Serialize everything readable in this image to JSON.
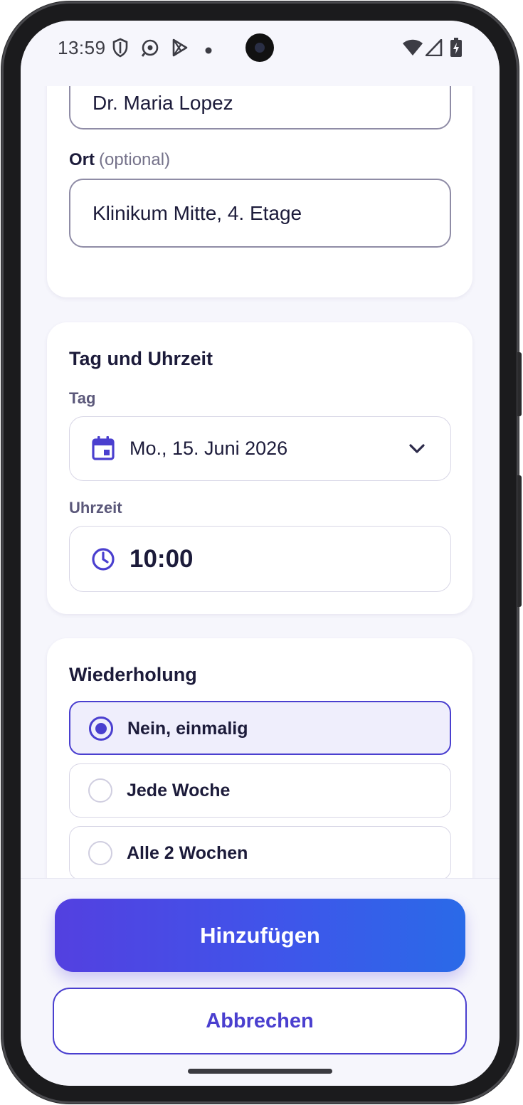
{
  "status_bar": {
    "time": "13:59",
    "icons_left": [
      "shield-icon",
      "notification-icon",
      "play-store-icon",
      "dot-icon"
    ],
    "icons_right": [
      "wifi-icon",
      "cell-signal-icon",
      "battery-charging-icon"
    ]
  },
  "details_card": {
    "doctor_value": "Dr. Maria Lopez",
    "location_label": "Ort",
    "location_optional": "(optional)",
    "location_value": "Klinikum Mitte, 4. Etage"
  },
  "datetime_card": {
    "title": "Tag und Uhrzeit",
    "day_label": "Tag",
    "day_value": "Mo., 15. Juni 2026",
    "time_label": "Uhrzeit",
    "time_value": "10:00"
  },
  "repeat_card": {
    "title": "Wiederholung",
    "options": [
      {
        "label": "Nein, einmalig",
        "selected": true
      },
      {
        "label": "Jede Woche",
        "selected": false
      },
      {
        "label": "Alle 2 Wochen",
        "selected": false
      }
    ]
  },
  "actions": {
    "primary_label": "Hinzufügen",
    "secondary_label": "Abbrechen"
  },
  "colors": {
    "accent": "#4a3fcf",
    "gradient_start": "#5340e0",
    "gradient_end": "#2a6ae8",
    "background": "#f6f6fc"
  }
}
